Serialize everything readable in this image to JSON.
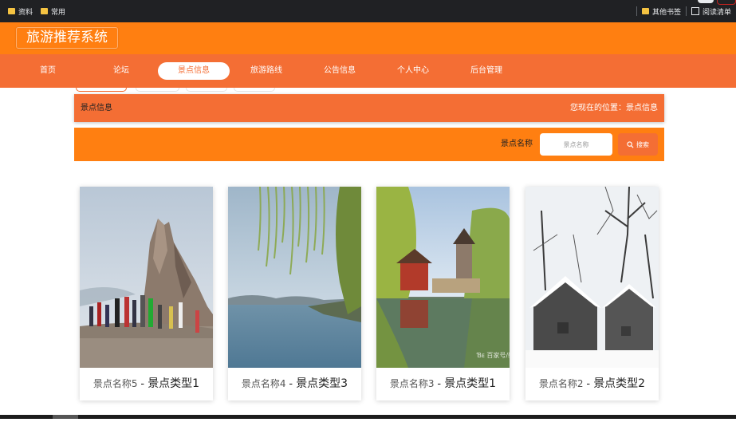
{
  "bookmarks": {
    "left": [
      {
        "label": "资料",
        "icon": "folder-icon"
      },
      {
        "label": "常用",
        "icon": "folder-icon"
      }
    ],
    "right": [
      {
        "label": "其他书签",
        "icon": "folder-icon"
      },
      {
        "label": "阅读清单",
        "icon": "reader-icon"
      }
    ]
  },
  "header": {
    "logo": "旅游推荐系统"
  },
  "nav": {
    "items": [
      {
        "label": "首页"
      },
      {
        "label": "论坛"
      },
      {
        "label": "景点信息",
        "active": true
      },
      {
        "label": "旅游路线"
      },
      {
        "label": "公告信息"
      },
      {
        "label": "个人中心"
      },
      {
        "label": "后台管理"
      }
    ]
  },
  "breadcrumb": {
    "title": "景点信息",
    "location": "您现在的位置：景点信息"
  },
  "search": {
    "label": "景点名称",
    "placeholder": "景点名称",
    "button": "搜索"
  },
  "cards": [
    {
      "name": "景点名称5",
      "type": "景点类型1",
      "scene": "rock-peak"
    },
    {
      "name": "景点名称4",
      "type": "景点类型3",
      "scene": "lake-willow"
    },
    {
      "name": "景点名称3",
      "type": "景点类型1",
      "scene": "pavilion-pond",
      "watermark": "Ɓᴇ 百家号/新"
    },
    {
      "name": "景点名称2",
      "type": "景点类型2",
      "scene": "snow-village"
    }
  ],
  "colors": {
    "header": "#ff7f11",
    "nav": "#f46e34",
    "accent": "#f46e34"
  }
}
